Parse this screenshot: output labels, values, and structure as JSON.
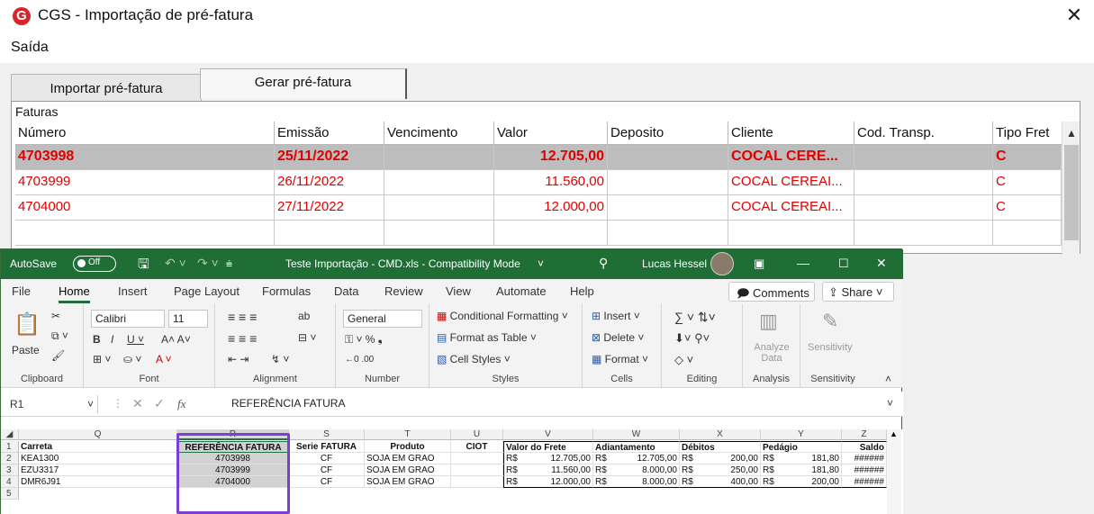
{
  "cgs": {
    "logo": "G",
    "title": "CGS - Importação de pré-fatura",
    "close": "✕",
    "menu": [
      "Saída"
    ],
    "tabs": [
      "Importar pré-fatura",
      "Gerar pré-fatura"
    ],
    "group_label": "Faturas",
    "columns": [
      "Número",
      "Emissão",
      "Vencimento",
      "Valor",
      "Deposito",
      "Cliente",
      "Cod. Transp.",
      "Tipo Fret"
    ],
    "rows": [
      {
        "numero": "4703998",
        "emissao": "25/11/2022",
        "vencimento": "",
        "valor": "12.705,00",
        "deposito": "",
        "cliente": "COCAL CERE...",
        "cod": "",
        "tipo": "C"
      },
      {
        "numero": "4703999",
        "emissao": "26/11/2022",
        "vencimento": "",
        "valor": "11.560,00",
        "deposito": "",
        "cliente": "COCAL CEREAI...",
        "cod": "",
        "tipo": "C"
      },
      {
        "numero": "4704000",
        "emissao": "27/11/2022",
        "vencimento": "",
        "valor": "12.000,00",
        "deposito": "",
        "cliente": "COCAL CEREAI...",
        "cod": "",
        "tipo": "C"
      }
    ],
    "text_color": "#e00000",
    "selected_row_bg": "#bdbdbd"
  },
  "excel": {
    "autosave_label": "AutoSave",
    "autosave_state": "Off",
    "title": "Teste Importação - CMD.xls  -  Compatibility Mode",
    "user": "Lucas Hessel",
    "title_bar_color": "#1e6e36",
    "menu": [
      "File",
      "Home",
      "Insert",
      "Page Layout",
      "Formulas",
      "Data",
      "Review",
      "View",
      "Automate",
      "Help"
    ],
    "comments_label": "Comments",
    "share_label": "Share",
    "ribbon": {
      "paste": "Paste",
      "font_name": "Calibri",
      "font_size": "11",
      "number_format": "General",
      "conditional_formatting": "Conditional Formatting",
      "format_as_table": "Format as Table",
      "cell_styles": "Cell Styles",
      "insert": "Insert",
      "delete": "Delete",
      "format": "Format",
      "analyze_data": "Analyze Data",
      "sensitivity": "Sensitivity",
      "groups": [
        "Clipboard",
        "Font",
        "Alignment",
        "Number",
        "Styles",
        "Cells",
        "Editing",
        "Analysis",
        "Sensitivity"
      ]
    },
    "name_box": "R1",
    "fx": "fx",
    "formula": "REFERÊNCIA FATURA",
    "col_letters": [
      "Q",
      "R",
      "S",
      "T",
      "U",
      "V",
      "W",
      "X",
      "Y",
      "Z"
    ],
    "row_numbers": [
      "1",
      "2",
      "3",
      "4",
      "5"
    ],
    "headers": [
      "Carreta",
      "REFERÊNCIA FATURA",
      "Serie FATURA",
      "Produto",
      "CIOT",
      "Valor do Frete",
      "Adiantamento",
      "Débitos",
      "Pedágio",
      "Saldo"
    ],
    "rows": [
      {
        "carreta": "KEA1300",
        "ref": "4703998",
        "serie": "CF",
        "produto": "SOJA EM GRAO",
        "ciot": "",
        "frete_cur": "R$",
        "frete": "12.705,00",
        "adiant_cur": "R$",
        "adiant": "12.705,00",
        "deb_cur": "R$",
        "deb": "200,00",
        "ped_cur": "R$",
        "ped": "181,80",
        "saldo": "######"
      },
      {
        "carreta": "EZU3317",
        "ref": "4703999",
        "serie": "CF",
        "produto": "SOJA EM GRAO",
        "ciot": "",
        "frete_cur": "R$",
        "frete": "11.560,00",
        "adiant_cur": "R$",
        "adiant": "8.000,00",
        "deb_cur": "R$",
        "deb": "250,00",
        "ped_cur": "R$",
        "ped": "181,80",
        "saldo": "######"
      },
      {
        "carreta": "DMR6J91",
        "ref": "4704000",
        "serie": "CF",
        "produto": "SOJA EM GRAO",
        "ciot": "",
        "frete_cur": "R$",
        "frete": "12.000,00",
        "adiant_cur": "R$",
        "adiant": "8.000,00",
        "deb_cur": "R$",
        "deb": "400,00",
        "ped_cur": "R$",
        "ped": "200,00",
        "saldo": "######"
      }
    ],
    "highlight_color": "#7b3fd6"
  }
}
